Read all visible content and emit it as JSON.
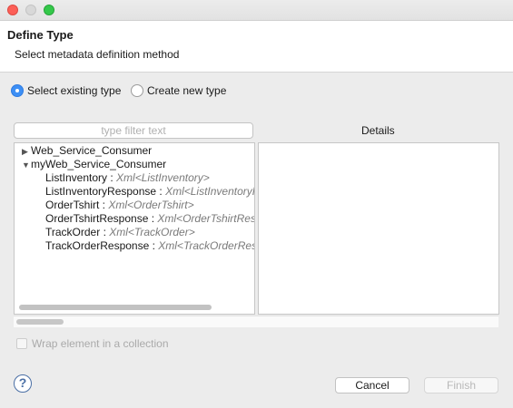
{
  "dialog": {
    "title": "Define Type",
    "subtitle": "Select metadata definition method"
  },
  "method": {
    "options": [
      {
        "label": "Select existing type",
        "selected": true
      },
      {
        "label": "Create new type",
        "selected": false
      }
    ]
  },
  "filter": {
    "placeholder": "type filter text",
    "value": ""
  },
  "details": {
    "label": "Details"
  },
  "tree": {
    "nodes": [
      {
        "label": "Web_Service_Consumer",
        "expanded": false
      },
      {
        "label": "myWeb_Service_Consumer",
        "expanded": true
      },
      {
        "label": "ListInventory : ",
        "type": "Xml<ListInventory>"
      },
      {
        "label": "ListInventoryResponse : ",
        "type": "Xml<ListInventoryR"
      },
      {
        "label": "OrderTshirt : ",
        "type": "Xml<OrderTshirt>"
      },
      {
        "label": "OrderTshirtResponse : ",
        "type": "Xml<OrderTshirtResp"
      },
      {
        "label": "TrackOrder : ",
        "type": "Xml<TrackOrder>"
      },
      {
        "label": "TrackOrderResponse : ",
        "type": "Xml<TrackOrderResp"
      }
    ]
  },
  "wrap": {
    "label": "Wrap element in a collection",
    "checked": false,
    "enabled": false
  },
  "help": {
    "icon": "question-mark-icon",
    "glyph": "?"
  },
  "buttons": {
    "cancel": "Cancel",
    "finish": "Finish"
  },
  "colors": {
    "radio_selected": "#3d8ff5",
    "window_close": "#fc5f57",
    "window_zoom": "#34c84a"
  }
}
